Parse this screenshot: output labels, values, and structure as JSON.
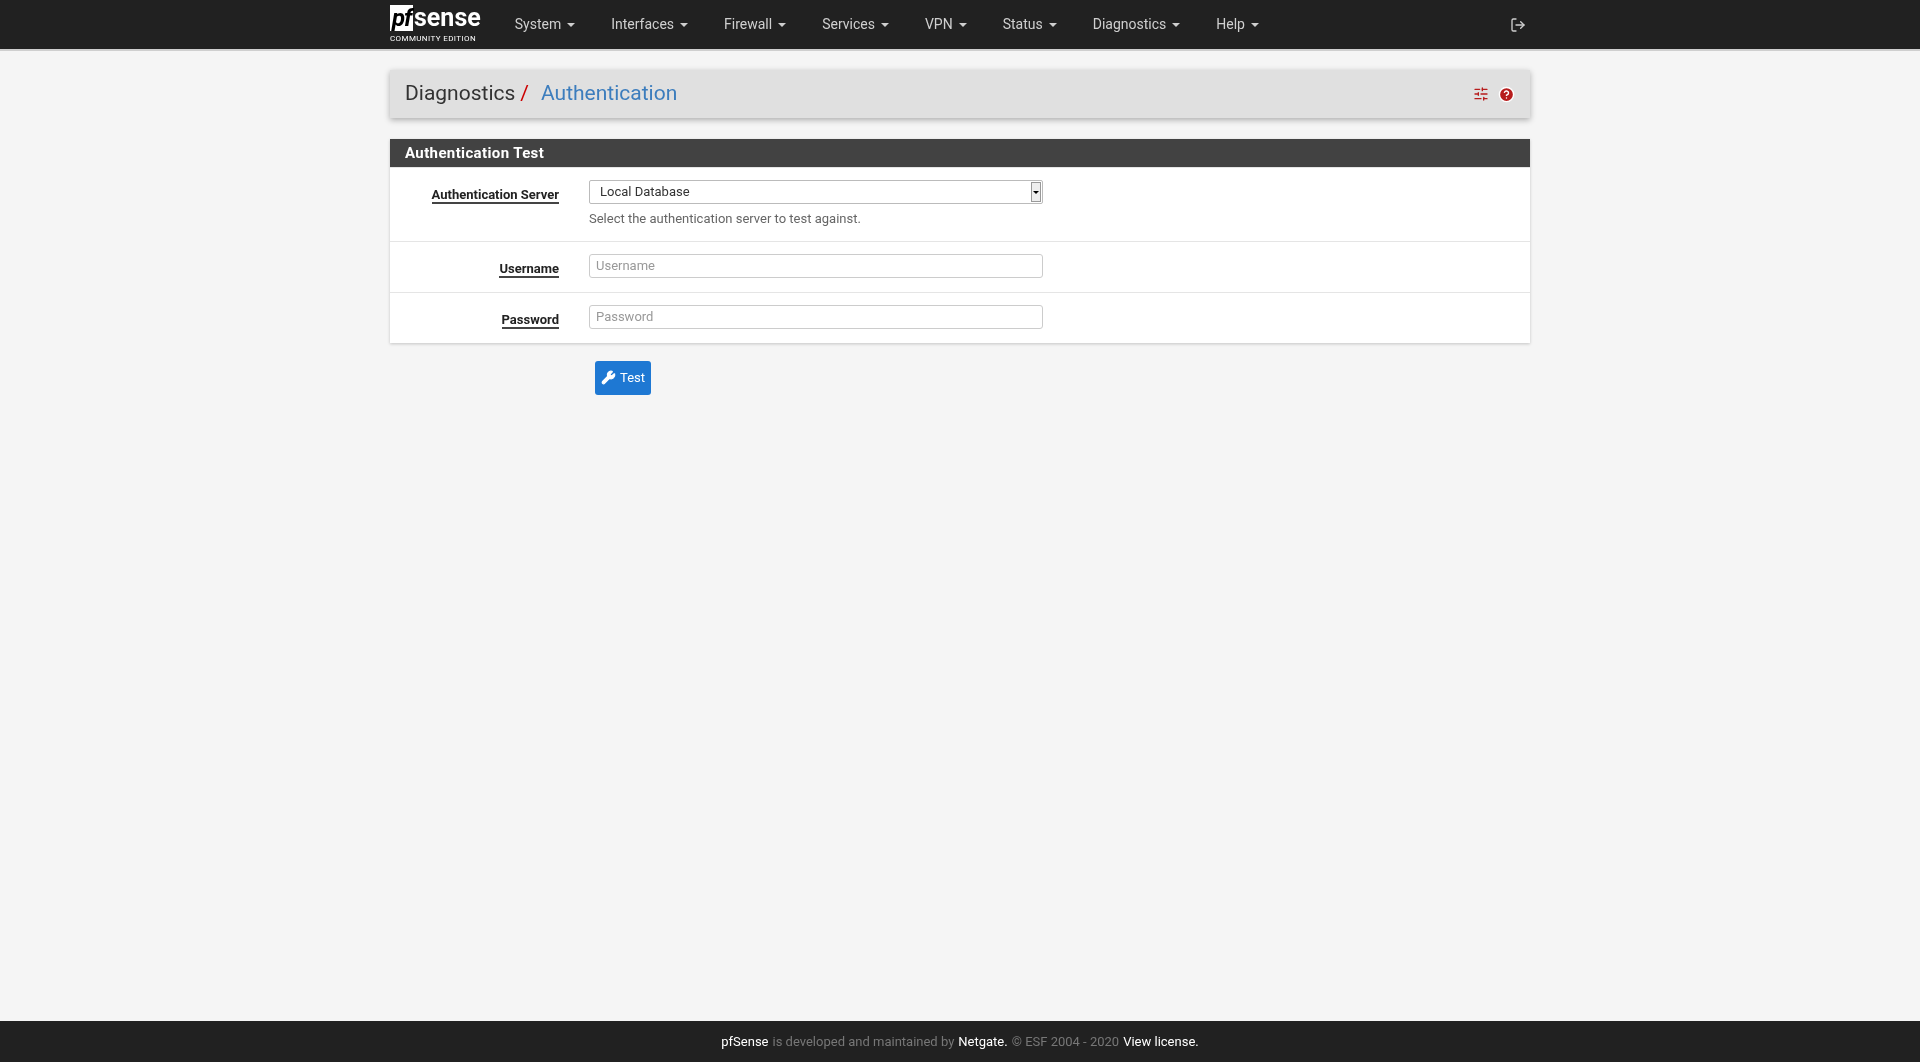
{
  "logo": {
    "mark": "pf",
    "word": "sense",
    "edition": "COMMUNITY EDITION"
  },
  "nav": [
    {
      "label": "System"
    },
    {
      "label": "Interfaces"
    },
    {
      "label": "Firewall"
    },
    {
      "label": "Services"
    },
    {
      "label": "VPN"
    },
    {
      "label": "Status"
    },
    {
      "label": "Diagnostics"
    },
    {
      "label": "Help"
    }
  ],
  "breadcrumb": {
    "parent": "Diagnostics",
    "separator": "/",
    "current": "Authentication"
  },
  "panel": {
    "title": "Authentication Test",
    "rows": [
      {
        "kind": "select",
        "label": "Authentication Server",
        "value": "Local Database",
        "help": "Select the authentication server to test against."
      },
      {
        "kind": "text",
        "label": "Username",
        "placeholder": "Username"
      },
      {
        "kind": "text",
        "label": "Password",
        "placeholder": "Password"
      }
    ]
  },
  "button": {
    "label": "Test"
  },
  "footer": [
    {
      "kind": "link",
      "text": "pfSense"
    },
    {
      "kind": "text",
      "text": "is developed and maintained by"
    },
    {
      "kind": "link",
      "text": "Netgate."
    },
    {
      "kind": "text",
      "text": "© ESF 2004 - 2020"
    },
    {
      "kind": "link",
      "text": "View license."
    }
  ]
}
